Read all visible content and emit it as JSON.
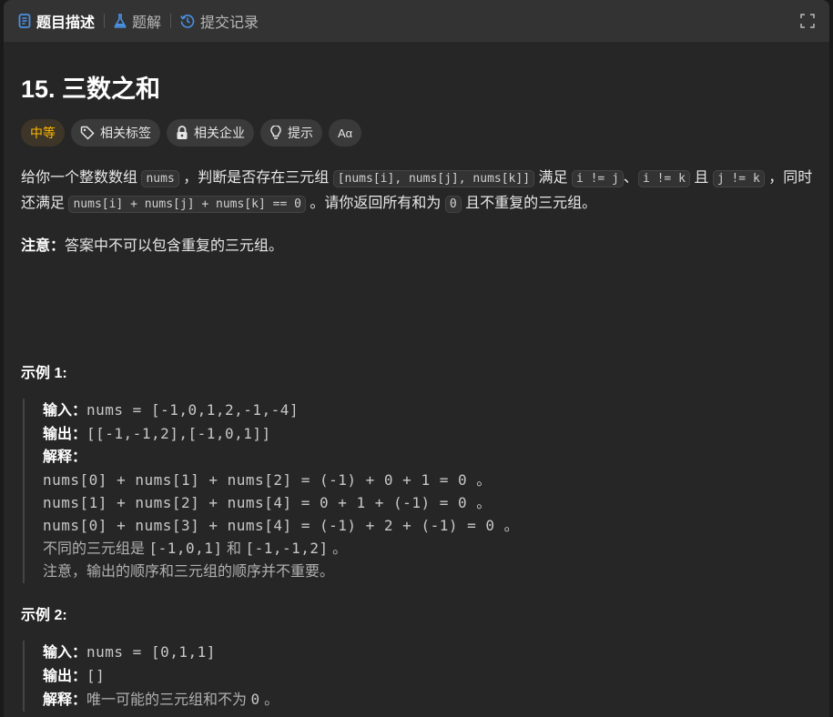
{
  "tabs": [
    {
      "label": "题目描述",
      "icon": "document-icon",
      "active": true
    },
    {
      "label": "题解",
      "icon": "flask-icon",
      "active": false
    },
    {
      "label": "提交记录",
      "icon": "history-icon",
      "active": false
    }
  ],
  "title": "15. 三数之和",
  "tags": {
    "difficulty": "中等",
    "related_tags": "相关标签",
    "related_companies": "相关企业",
    "hint": "提示",
    "translate": "Aα"
  },
  "description": {
    "p1_a": "给你一个整数数组",
    "code_nums": "nums",
    "p1_b": "，判断是否存在三元组",
    "code_triple": "[nums[i], nums[j], nums[k]]",
    "p1_c": "满足",
    "code_ij": "i != j",
    "p1_d": "、",
    "code_ik": "i != k",
    "p1_e": "且",
    "code_jk": "j != k",
    "p1_f": "，同时还满足",
    "code_sum": "nums[i] + nums[j] + nums[k] == 0",
    "p1_g": "。请你返回所有和为",
    "code_zero": "0",
    "p1_h": "且不重复的三元组。"
  },
  "note": {
    "label": "注意：",
    "text": "答案中不可以包含重复的三元组。"
  },
  "examples": [
    {
      "title": "示例 1:",
      "input_label": "输入：",
      "input": "nums = [-1,0,1,2,-1,-4]",
      "output_label": "输出：",
      "output": "[[-1,-1,2],[-1,0,1]]",
      "explain_label": "解释：",
      "lines": [
        "nums[0] + nums[1] + nums[2] = (-1) + 0 + 1 = 0 。",
        "nums[1] + nums[2] + nums[4] = 0 + 1 + (-1) = 0 。",
        "nums[0] + nums[3] + nums[4] = (-1) + 2 + (-1) = 0 。"
      ],
      "line4_a": "不同的三元组是",
      "line4_b": "[-1,0,1]",
      "line4_c": "和",
      "line4_d": "[-1,-1,2]",
      "line4_e": "。",
      "line5": "注意，输出的顺序和三元组的顺序并不重要。"
    },
    {
      "title": "示例 2:",
      "input_label": "输入：",
      "input": "nums = [0,1,1]",
      "output_label": "输出：",
      "output": "[]",
      "explain_label": "解释：",
      "explain_a": "唯一可能的三元组和不为",
      "explain_b": "0",
      "explain_c": "。"
    }
  ]
}
